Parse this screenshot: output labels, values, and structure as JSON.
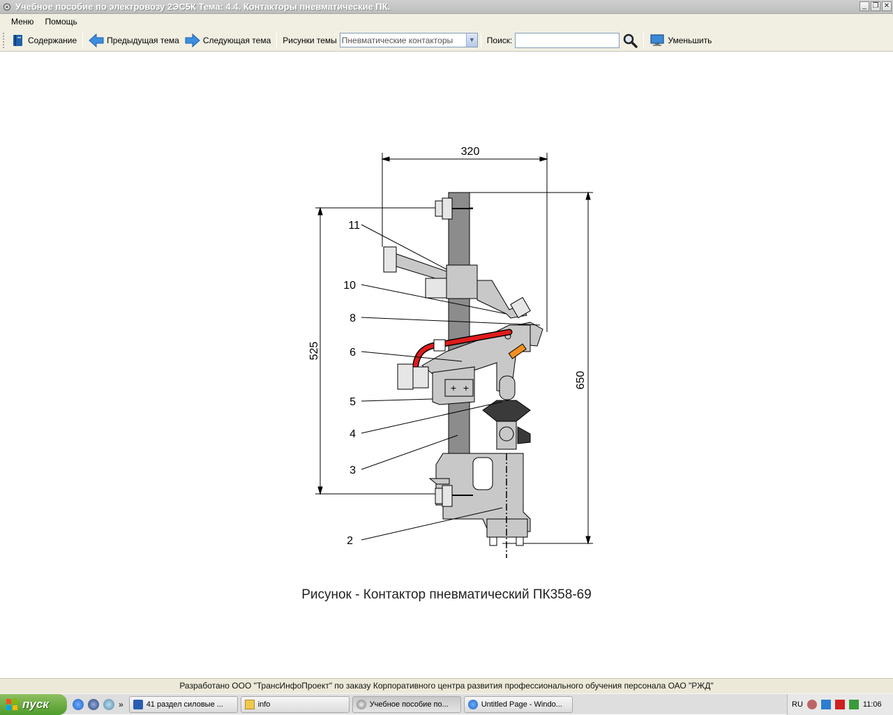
{
  "window": {
    "title": "Учебное пособие по электровозу 2ЭС5К Тема: 4.4. Контакторы пневматические ПК.",
    "controls": [
      "_",
      "❐",
      "✕"
    ]
  },
  "menu": {
    "items": [
      "Меню",
      "Помощь"
    ]
  },
  "toolbar": {
    "contents_label": "Содержание",
    "prev_label": "Предыдущая тема",
    "next_label": "Следующая тема",
    "figures_label": "Рисунки темы",
    "figures_selected": "Пневматические контакторы",
    "search_label": "Поиск:",
    "search_value": "",
    "shrink_label": "Уменьшить"
  },
  "figure": {
    "caption": "Рисунок - Контактор пневматический ПК358-69",
    "dimensions": {
      "width": "320",
      "height_inner": "525",
      "height_total": "650"
    },
    "callouts": [
      "11",
      "10",
      "8",
      "6",
      "5",
      "4",
      "3",
      "2"
    ],
    "colors": {
      "body": "#c8c8c8",
      "post": "#8c8c8c",
      "arc": "#e11b1b",
      "spring": "#f09020",
      "outline": "#000000"
    }
  },
  "footer": {
    "text": "Разработано ООО \"ТрансИнфоПроект\" по заказу Корпоративного центра развития профессионального обучения персонала ОАО \"РЖД\""
  },
  "taskbar": {
    "start_label": "пуск",
    "quick_more": "»",
    "tasks": [
      {
        "label": "41 раздел силовые ...",
        "icon": "word-icon"
      },
      {
        "label": "info",
        "icon": "folder-icon"
      },
      {
        "label": "Учебное пособие по...",
        "icon": "gear-icon"
      },
      {
        "label": "Untitled Page - Windo...",
        "icon": "ie-icon"
      }
    ],
    "tray": {
      "lang": "RU",
      "time": "11:06"
    }
  }
}
